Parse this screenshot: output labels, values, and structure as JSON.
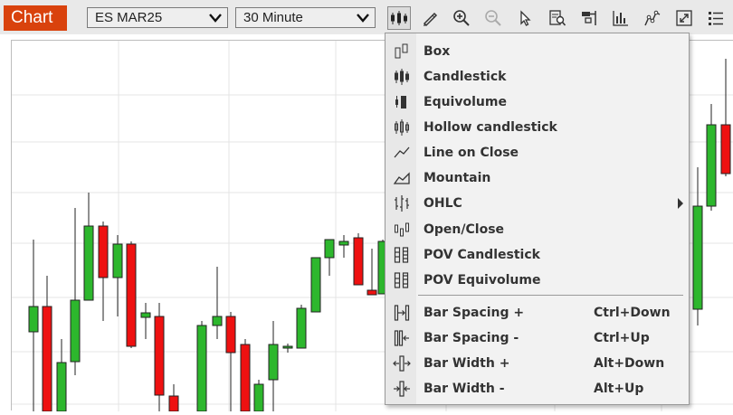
{
  "header": {
    "chart_tab": "Chart",
    "symbol": "ES MAR25",
    "interval": "30 Minute"
  },
  "toolbar": {
    "icons": [
      "candlestick-type-icon",
      "draw-icon",
      "zoom-in-icon",
      "zoom-out-icon",
      "cursor-icon",
      "find-icon",
      "study-icon",
      "volume-bars-icon",
      "indicator-icon",
      "resize-icon",
      "list-icon"
    ]
  },
  "menu": {
    "chart_types": [
      {
        "label": "Box",
        "icon": "box-icon"
      },
      {
        "label": "Candlestick",
        "icon": "candlestick-icon"
      },
      {
        "label": "Equivolume",
        "icon": "equivolume-icon"
      },
      {
        "label": "Hollow candlestick",
        "icon": "hollow-candlestick-icon"
      },
      {
        "label": "Line on Close",
        "icon": "line-on-close-icon"
      },
      {
        "label": "Mountain",
        "icon": "mountain-icon"
      },
      {
        "label": "OHLC",
        "icon": "ohlc-icon",
        "submenu": true
      },
      {
        "label": "Open/Close",
        "icon": "open-close-icon"
      },
      {
        "label": "POV Candlestick",
        "icon": "pov-candlestick-icon"
      },
      {
        "label": "POV Equivolume",
        "icon": "pov-equivolume-icon"
      }
    ],
    "bar_actions": [
      {
        "label": "Bar Spacing +",
        "shortcut": "Ctrl+Down",
        "icon": "bar-spacing-plus-icon"
      },
      {
        "label": "Bar Spacing -",
        "shortcut": "Ctrl+Up",
        "icon": "bar-spacing-minus-icon"
      },
      {
        "label": "Bar Width +",
        "shortcut": "Alt+Down",
        "icon": "bar-width-plus-icon"
      },
      {
        "label": "Bar Width -",
        "shortcut": "Alt+Up",
        "icon": "bar-width-minus-icon"
      }
    ]
  },
  "colors": {
    "up": "#2db72d",
    "down": "#ee1111",
    "accent": "#d9420d",
    "grid": "#e4e4e4"
  }
}
